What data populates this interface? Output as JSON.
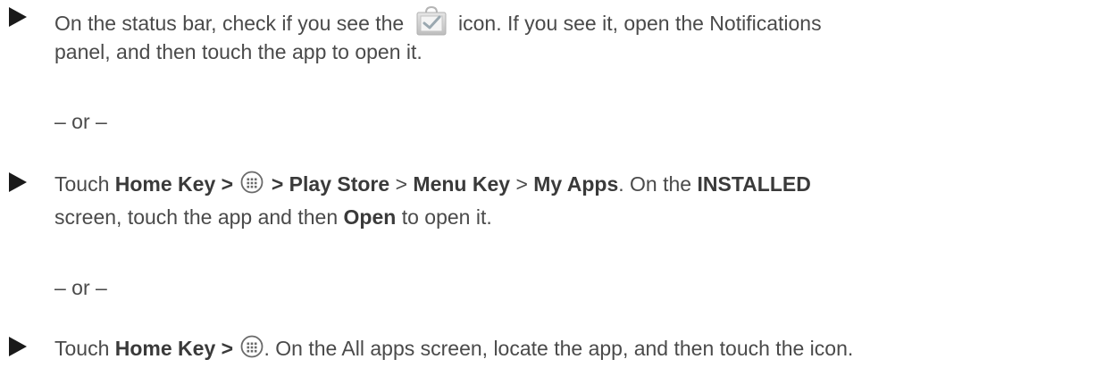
{
  "step1": {
    "line1_before": "On the status bar, check if you see the",
    "line1_after": "icon. If you see it, open the Notifications",
    "line2": "panel, and then touch the app to open it."
  },
  "or1": "– or –",
  "step2": {
    "touch": "Touch",
    "home_key": "Home Key >",
    "play_store": "> Play Store",
    "sep1": ">",
    "menu_key": "Menu Key",
    "sep2": ">",
    "my_apps": "My Apps",
    "on_the": ". On the",
    "installed": "INSTALLED",
    "line2_a": "screen, touch the app and then",
    "open": "Open",
    "line2_b": "to open it."
  },
  "or2": "– or –",
  "step3": {
    "touch": "Touch",
    "home_key": "Home Key >",
    "rest": ". On the All apps screen, locate the app, and then touch the icon."
  },
  "icons": {
    "bullet": "triangle-right-icon",
    "status": "play-store-bag-icon",
    "apps": "apps-grid-icon"
  }
}
